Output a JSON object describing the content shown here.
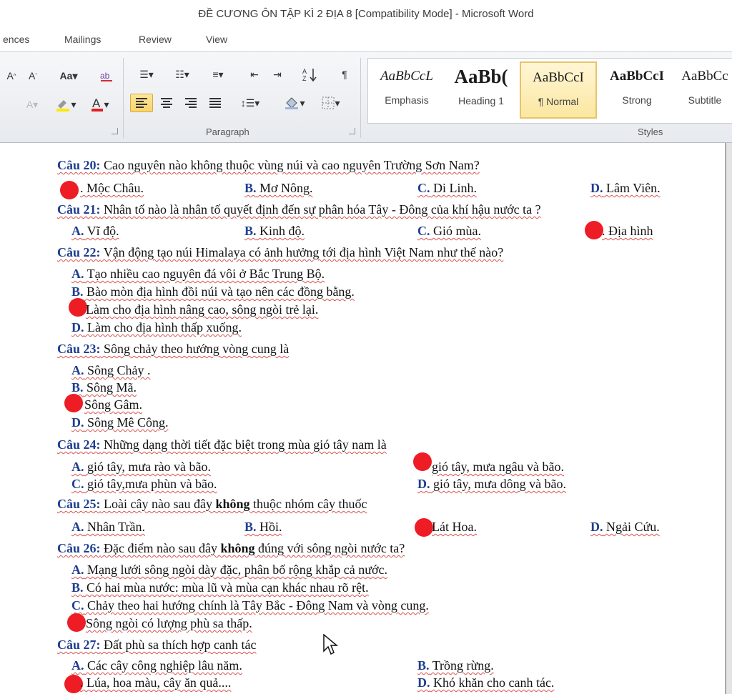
{
  "window": {
    "title": "ĐỀ CƯƠNG ÔN TẬP KÌ 2 ĐỊA 8 [Compatibility Mode]  -  Microsoft Word"
  },
  "tabs": [
    "ences",
    "Mailings",
    "Review",
    "View"
  ],
  "ribbon": {
    "paragraph_label": "Paragraph",
    "styles_label": "Styles",
    "font_aa": "Aa",
    "styles": [
      {
        "sample": "AaBbCcL",
        "name": "Emphasis"
      },
      {
        "sample": "AaBb(",
        "name": "Heading 1"
      },
      {
        "sample": "AaBbCcI",
        "name": "¶ Normal"
      },
      {
        "sample": "AaBbCcI",
        "name": "Strong"
      },
      {
        "sample": "AaBbCc",
        "name": "Subtitle"
      }
    ]
  },
  "doc": {
    "q20": {
      "label": "Câu 20:",
      "text": " Cao nguyên nào không thuộc vùng núi và cao nguyên Trường Sơn Nam?",
      "a": ". Mộc Châu.",
      "b": "B.",
      "b_t": " Mơ Nông.",
      "c": "C.",
      "c_t": " Di Linh.",
      "d": "D.",
      "d_t": " Lâm Viên."
    },
    "q21": {
      "label": "Câu 21:",
      "text": " Nhân tố nào là nhân tố quyết định đến sự phân hóa Tây - Đông của khí hậu nước ta ?",
      "a": "A.",
      "a_t": " Vĩ độ.",
      "b": "B.",
      "b_t": " Kinh độ.",
      "c": "C.",
      "c_t": " Gió mùa.",
      "d": ". Địa hình"
    },
    "q22": {
      "label": "Câu 22:",
      "text": " Vận động tạo núi Himalaya có ảnh hưởng tới địa hình Việt Nam như thế nào?",
      "a": "A.",
      "a_t": " Tạo nhiều cao nguyên đá vôi ở Bắc Trung Bộ.",
      "b": "B.",
      "b_t": " Bào mòn địa hình đồi núi và tạo nên các đồng bằng.",
      "c": " Làm cho địa hình nâng cao, sông ngòi trẻ lại.",
      "d": "D.",
      "d_t": " Làm cho địa hình thấp xuống."
    },
    "q23": {
      "label": "Câu 23:",
      "text": " Sông chảy theo hướng vòng cung là",
      "a": "A.",
      "a_t": " Sông Chảy .",
      "b": "B.",
      "b_t": " Sông Mã.",
      "c": " Sông Gâm.",
      "d": "D.",
      "d_t": " Sông Mê Công."
    },
    "q24": {
      "label": "Câu 24:",
      "text": " Những dạng thời tiết đặc biệt trong mùa gió tây nam là",
      "a": "A.",
      "a_t": " gió tây, mưa rào và bão.",
      "b": " gió tây, mưa ngâu và bão.",
      "c": "C.",
      "c_t": " gió tây,mưa phùn và bão.",
      "d": "D.",
      "d_t": " gió tây, mưa dông và bão."
    },
    "q25": {
      "label": "Câu 25:",
      "text_pre": " Loài cây nào sau đây ",
      "text_bold": "không",
      "text_post": " thuộc nhóm cây thuốc",
      "a": "A.",
      "a_t": " Nhân Trần.",
      "b": "B.",
      "b_t": " Hồi.",
      "c": "  Lát Hoa.",
      "d": "D.",
      "d_t": " Ngải Cứu."
    },
    "q26": {
      "label": "Câu 26:",
      "text_pre": " Đặc điểm nào sau đây ",
      "text_bold": "không",
      "text_post": " đúng với sông ngòi nước ta?",
      "a": "A.",
      "a_t": " Mạng lưới sông ngòi dày đặc, phân bố rộng khắp cả nước.",
      "b": "B.",
      "b_t": " Có hai mùa nước: mùa lũ và mùa cạn khác nhau rõ rệt.",
      "c": "C.",
      "c_t": " Chảy theo hai hướng chính là Tây Bắc - Đông Nam và vòng cung.",
      "d": " Sông ngòi có lượng phù sa thấp."
    },
    "q27": {
      "label": "Câu 27:",
      "text": " Đất phù sa thích hợp canh tác",
      "a": "A.",
      "a_t": " Các cây công nghiệp lâu năm.",
      "b": "B.",
      "b_t": " Trồng rừng.",
      "c": ". Lúa, hoa màu, cây ăn quả....",
      "d": "D.",
      "d_t": " Khó khăn cho canh tác."
    }
  },
  "colors": {
    "question_label": "#1f3f8f",
    "answer_mark": "#ee1c25",
    "spell_underline": "#d9534f"
  }
}
